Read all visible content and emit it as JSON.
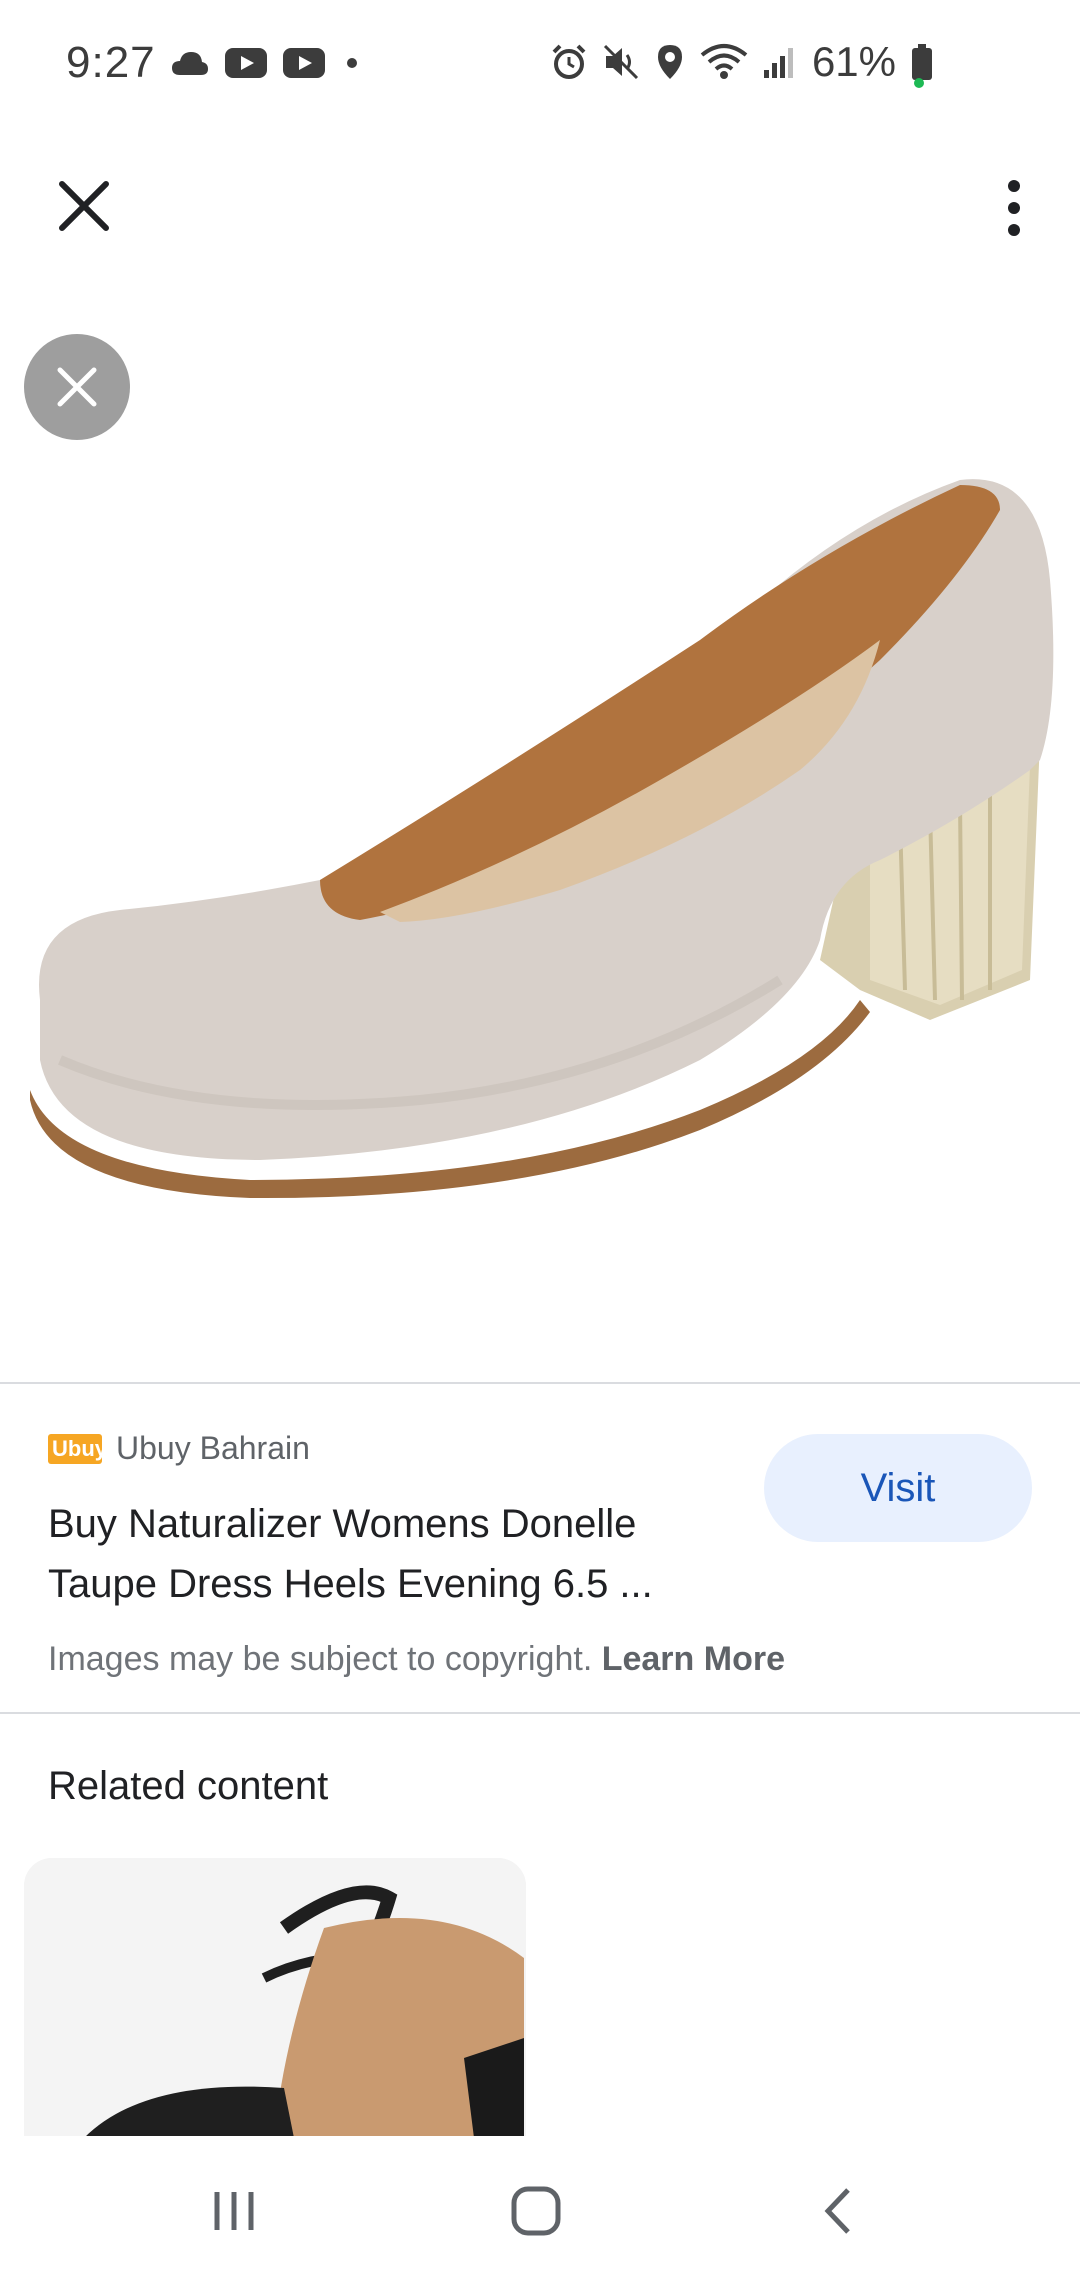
{
  "status_bar": {
    "time": "9:27",
    "battery": "61%",
    "icons_left": [
      "cloud-icon",
      "youtube-icon",
      "youtube-icon",
      "dot-icon"
    ],
    "icons_right": [
      "alarm-icon",
      "mute-icon",
      "location-icon",
      "wifi-icon",
      "signal-icon",
      "battery-icon"
    ]
  },
  "top_bar": {
    "close_icon": "close-icon",
    "more_icon": "more-vert-icon"
  },
  "viewer": {
    "overlay_close_icon": "close-icon",
    "image_subject": "taupe suede block-heel pump"
  },
  "result": {
    "source_logo_text": "Ubuy",
    "source_name": "Ubuy Bahrain",
    "title": "Buy Naturalizer Womens Donelle Taupe Dress Heels Evening 6.5 ...",
    "visit_label": "Visit",
    "copyright_text": "Images may be subject to copyright. ",
    "learn_more": "Learn More"
  },
  "related": {
    "heading": "Related content"
  },
  "nav_bar": {
    "items": [
      "recents-icon",
      "home-icon",
      "back-icon"
    ]
  },
  "colors": {
    "accent": "#1a56b8",
    "visit_bg": "#e8f0fe",
    "overlay_btn": "#9e9e9e",
    "logo": "#f6a623"
  }
}
